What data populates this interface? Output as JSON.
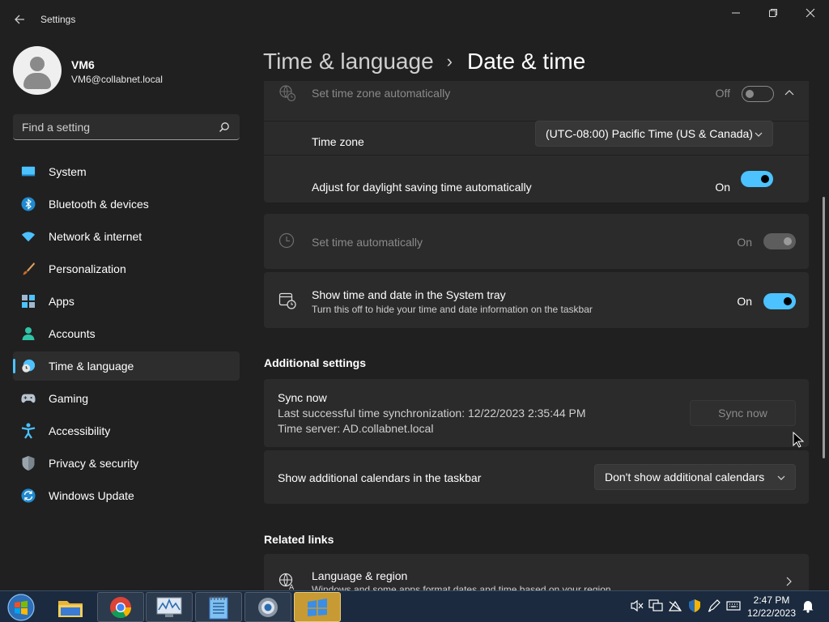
{
  "window": {
    "title": "Settings"
  },
  "profile": {
    "name": "VM6",
    "email": "VM6@collabnet.local"
  },
  "search": {
    "placeholder": "Find a setting"
  },
  "sidebar": {
    "items": [
      {
        "label": "System",
        "icon": "system-icon"
      },
      {
        "label": "Bluetooth & devices",
        "icon": "bluetooth-icon"
      },
      {
        "label": "Network & internet",
        "icon": "wifi-icon"
      },
      {
        "label": "Personalization",
        "icon": "brush-icon"
      },
      {
        "label": "Apps",
        "icon": "apps-icon"
      },
      {
        "label": "Accounts",
        "icon": "accounts-icon"
      },
      {
        "label": "Time & language",
        "icon": "time-language-icon",
        "active": true
      },
      {
        "label": "Gaming",
        "icon": "gamepad-icon"
      },
      {
        "label": "Accessibility",
        "icon": "accessibility-icon"
      },
      {
        "label": "Privacy & security",
        "icon": "shield-icon"
      },
      {
        "label": "Windows Update",
        "icon": "update-icon"
      }
    ]
  },
  "header": {
    "parent": "Time & language",
    "separator": "›",
    "current": "Date & time"
  },
  "settings": {
    "timezone_auto": {
      "label": "Set time zone automatically",
      "state": "Off"
    },
    "timezone": {
      "label": "Time zone",
      "value": "(UTC-08:00) Pacific Time (US & Canada)"
    },
    "daylight": {
      "label": "Adjust for daylight saving time automatically",
      "state": "On"
    },
    "time_auto": {
      "label": "Set time automatically",
      "state": "On"
    },
    "tray": {
      "label": "Show time and date in the System tray",
      "description": "Turn this off to hide your time and date information on the taskbar",
      "state": "On"
    }
  },
  "additional": {
    "title": "Additional settings",
    "sync": {
      "label": "Sync now",
      "last_sync": "Last successful time synchronization: 12/22/2023 2:35:44 PM",
      "server": "Time server: AD.collabnet.local",
      "button": "Sync now"
    },
    "calendars": {
      "label": "Show additional calendars in the taskbar",
      "value": "Don't show additional calendars"
    }
  },
  "related": {
    "title": "Related links",
    "language_region": {
      "label": "Language & region",
      "description": "Windows and some apps format dates and time based on your region"
    }
  },
  "taskbar": {
    "time": "2:47 PM",
    "date": "12/22/2023",
    "apps": [
      "explorer-icon",
      "chrome-icon",
      "monitor-icon",
      "notepad-icon",
      "settings-icon",
      "windows-settings-icon"
    ]
  },
  "colors": {
    "accent": "#4cc2ff",
    "background": "#202020",
    "card": "#2b2b2b",
    "taskbar": "#1b2a3e"
  }
}
